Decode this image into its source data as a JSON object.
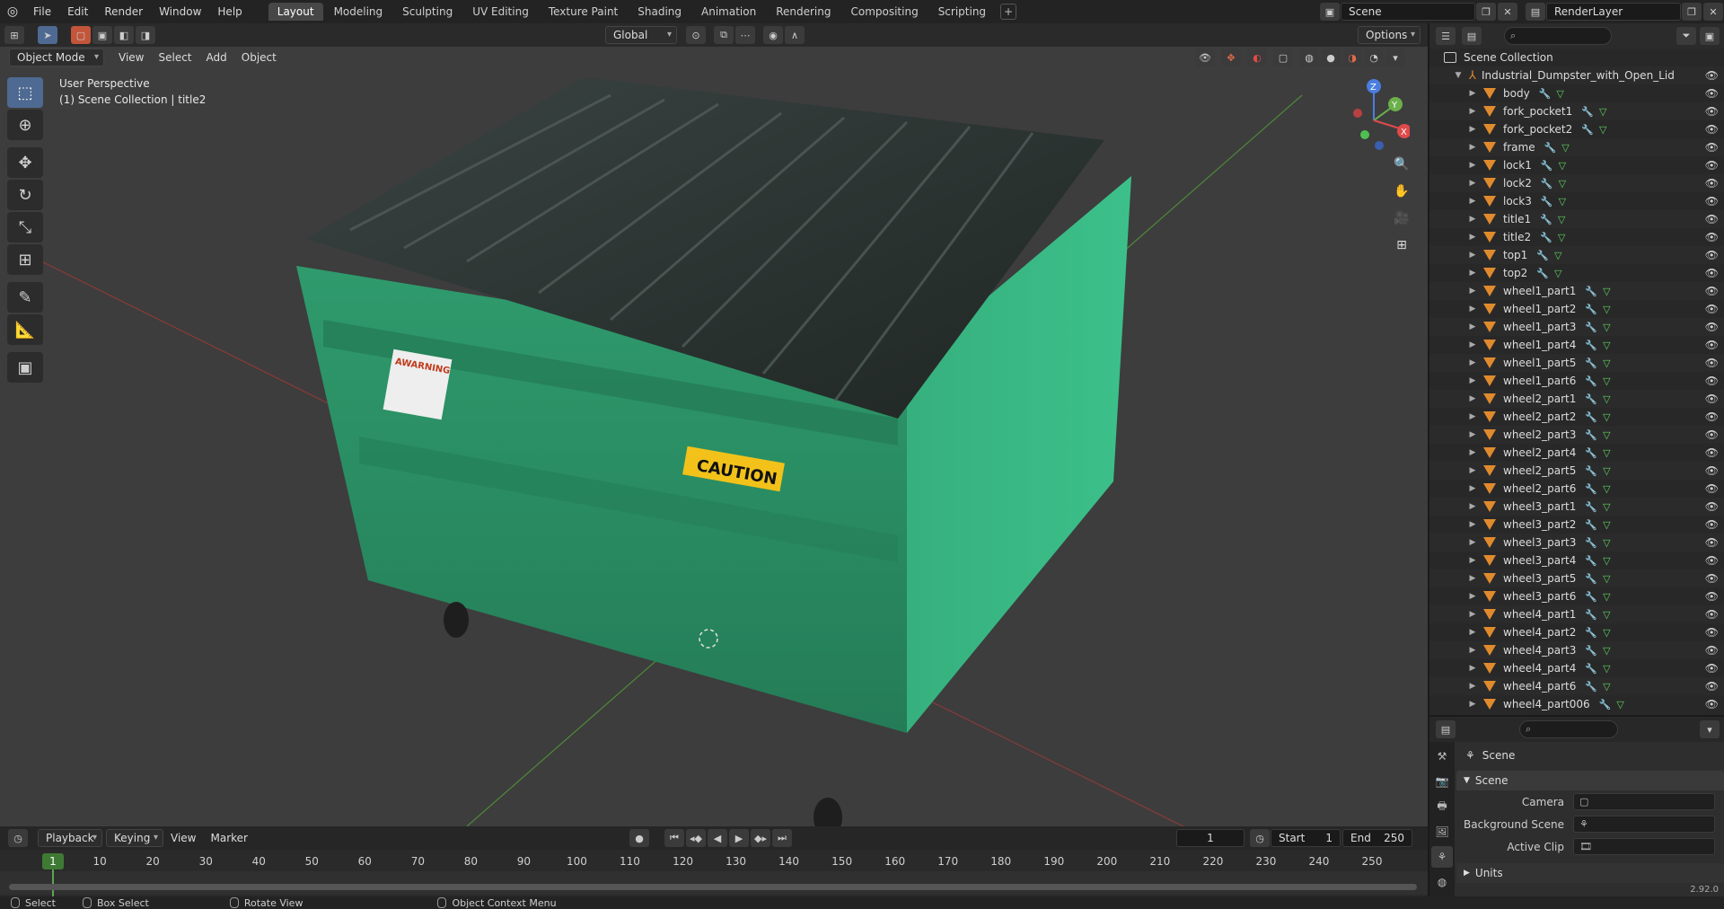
{
  "topbar": {
    "menus": [
      "File",
      "Edit",
      "Render",
      "Window",
      "Help"
    ],
    "workspaces": [
      {
        "label": "Layout",
        "active": true
      },
      {
        "label": "Modeling",
        "active": false
      },
      {
        "label": "Sculpting",
        "active": false
      },
      {
        "label": "UV Editing",
        "active": false
      },
      {
        "label": "Texture Paint",
        "active": false
      },
      {
        "label": "Shading",
        "active": false
      },
      {
        "label": "Animation",
        "active": false
      },
      {
        "label": "Rendering",
        "active": false
      },
      {
        "label": "Compositing",
        "active": false
      },
      {
        "label": "Scripting",
        "active": false
      }
    ],
    "add_tab": "+",
    "scene": "Scene",
    "render_layer": "RenderLayer"
  },
  "viewport": {
    "mode": "Object Mode",
    "menus": [
      "View",
      "Select",
      "Add",
      "Object"
    ],
    "transform_orientation": "Global",
    "options": "Options",
    "info_line1": "User Perspective",
    "info_line2": "(1) Scene Collection | title2",
    "gizmo": {
      "x": "X",
      "y": "Y",
      "z": "Z"
    },
    "caution_text": "CAUTION",
    "warning_text": "AWARNING"
  },
  "outliner": {
    "root": "Scene Collection",
    "parent": "Industrial_Dumpster_with_Open_Lid",
    "objects": [
      "body",
      "fork_pocket1",
      "fork_pocket2",
      "frame",
      "lock1",
      "lock2",
      "lock3",
      "title1",
      "title2",
      "top1",
      "top2",
      "wheel1_part1",
      "wheel1_part2",
      "wheel1_part3",
      "wheel1_part4",
      "wheel1_part5",
      "wheel1_part6",
      "wheel2_part1",
      "wheel2_part2",
      "wheel2_part3",
      "wheel2_part4",
      "wheel2_part5",
      "wheel2_part6",
      "wheel3_part1",
      "wheel3_part2",
      "wheel3_part3",
      "wheel3_part4",
      "wheel3_part5",
      "wheel3_part6",
      "wheel4_part1",
      "wheel4_part2",
      "wheel4_part3",
      "wheel4_part4",
      "wheel4_part6",
      "wheel4_part006"
    ]
  },
  "properties": {
    "context": "Scene",
    "section": "Scene",
    "camera_label": "Camera",
    "background_scene_label": "Background Scene",
    "active_clip_label": "Active Clip",
    "units_section": "Units",
    "version": "2.92.0"
  },
  "timeline": {
    "menus": [
      "Playback",
      "Keying",
      "View",
      "Marker"
    ],
    "current_frame": "1",
    "start_label": "Start",
    "start": "1",
    "end_label": "End",
    "end": "250",
    "ticks": [
      10,
      20,
      30,
      40,
      50,
      60,
      70,
      80,
      90,
      100,
      110,
      120,
      130,
      140,
      150,
      160,
      170,
      180,
      190,
      200,
      210,
      220,
      230,
      240,
      250
    ],
    "playhead": "1"
  },
  "statusbar": {
    "select": "Select",
    "box_select": "Box Select",
    "rotate_view": "Rotate View",
    "context_menu": "Object Context Menu"
  },
  "colors": {
    "accent": "#4a90e2",
    "dumpster": "#2f9e6e",
    "lid": "#2a3230",
    "object_icon": "#e08a2e"
  }
}
